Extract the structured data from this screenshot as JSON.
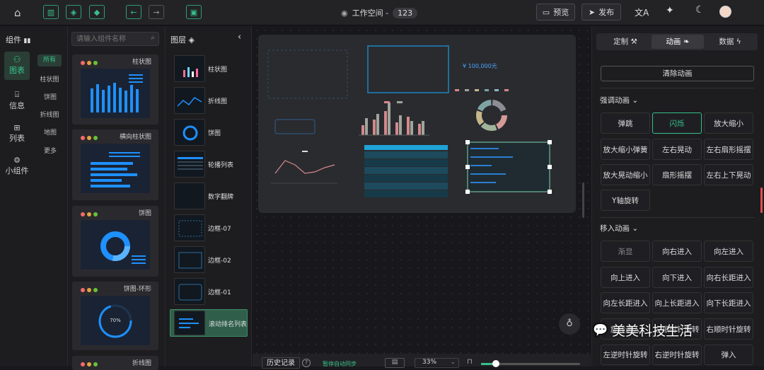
{
  "topbar": {
    "workspace_label": "工作空间 -",
    "workspace_id": "123",
    "preview_label": "预览",
    "publish_label": "发布"
  },
  "components": {
    "panel_title": "组件",
    "search_placeholder": "请输入组件名称",
    "categories": [
      "图表",
      "信息",
      "列表",
      "小组件"
    ],
    "subcategories": [
      "所有",
      "柱状图",
      "饼图",
      "折线图",
      "地图",
      "更多"
    ],
    "cards": [
      "柱状图",
      "横向柱状图",
      "饼图",
      "饼图-环形",
      "折线图"
    ],
    "ring_value": "70%"
  },
  "layers": {
    "title": "图层",
    "items": [
      "柱状图",
      "折线图",
      "饼图",
      "轮播列表",
      "数字翻牌",
      "边框-07",
      "边框-02",
      "边框-01",
      "滚动排名列表"
    ]
  },
  "canvas": {
    "money_value": "¥ 100,000元"
  },
  "bottombar": {
    "history_label": "历史记录",
    "sync_status": "暂停自动同步",
    "zoom": "33%"
  },
  "right": {
    "tabs": [
      "定制",
      "动画",
      "数据"
    ],
    "clear_button": "清除动画",
    "emphasis_title": "强调动画",
    "emphasis": [
      "弹跳",
      "闪烁",
      "放大缩小",
      "放大缩小弹簧",
      "左右晃动",
      "左右扇形摇摆",
      "放大晃动缩小",
      "扇形摇摆",
      "左右上下晃动",
      "Y轴旋转"
    ],
    "enter_title": "移入动画",
    "enter": [
      "渐显",
      "向右进入",
      "向左进入",
      "向上进入",
      "向下进入",
      "向右长距进入",
      "向左长距进入",
      "向上长距进入",
      "向下长距进入",
      "旋转进入",
      "左顺时针旋转",
      "右顺时针旋转",
      "左逆时针旋转",
      "右逆时针旋转",
      "弹入"
    ]
  },
  "watermark": "美美科技生活",
  "colors": {
    "accent": "#37c08a",
    "bar": "#1e90ff"
  }
}
